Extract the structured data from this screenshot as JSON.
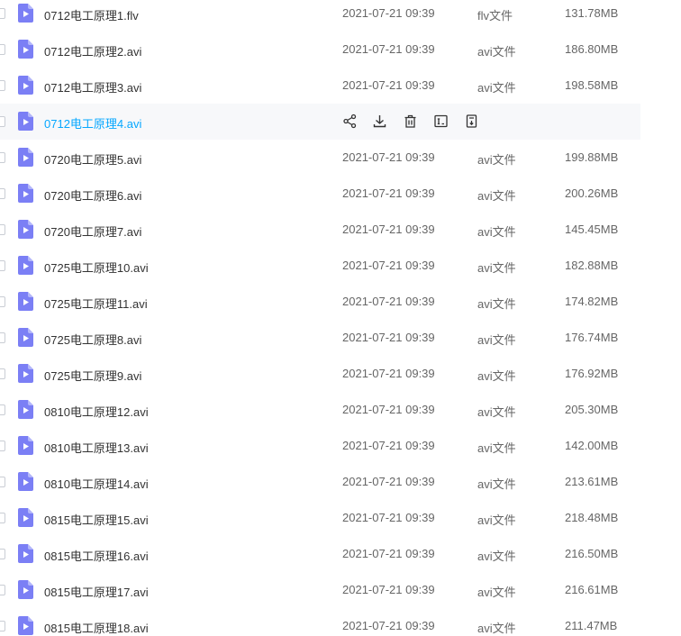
{
  "files": [
    {
      "name": "0712电工原理1.flv",
      "date": "2021-07-21 09:39",
      "type": "flv文件",
      "size": "131.78MB"
    },
    {
      "name": "0712电工原理2.avi",
      "date": "2021-07-21 09:39",
      "type": "avi文件",
      "size": "186.80MB"
    },
    {
      "name": "0712电工原理3.avi",
      "date": "2021-07-21 09:39",
      "type": "avi文件",
      "size": "198.58MB"
    },
    {
      "name": "0712电工原理4.avi",
      "date": "",
      "type": "",
      "size": "",
      "hovered": true
    },
    {
      "name": "0720电工原理5.avi",
      "date": "2021-07-21 09:39",
      "type": "avi文件",
      "size": "199.88MB"
    },
    {
      "name": "0720电工原理6.avi",
      "date": "2021-07-21 09:39",
      "type": "avi文件",
      "size": "200.26MB"
    },
    {
      "name": "0720电工原理7.avi",
      "date": "2021-07-21 09:39",
      "type": "avi文件",
      "size": "145.45MB"
    },
    {
      "name": "0725电工原理10.avi",
      "date": "2021-07-21 09:39",
      "type": "avi文件",
      "size": "182.88MB"
    },
    {
      "name": "0725电工原理11.avi",
      "date": "2021-07-21 09:39",
      "type": "avi文件",
      "size": "174.82MB"
    },
    {
      "name": "0725电工原理8.avi",
      "date": "2021-07-21 09:39",
      "type": "avi文件",
      "size": "176.74MB"
    },
    {
      "name": "0725电工原理9.avi",
      "date": "2021-07-21 09:39",
      "type": "avi文件",
      "size": "176.92MB"
    },
    {
      "name": "0810电工原理12.avi",
      "date": "2021-07-21 09:39",
      "type": "avi文件",
      "size": "205.30MB"
    },
    {
      "name": "0810电工原理13.avi",
      "date": "2021-07-21 09:39",
      "type": "avi文件",
      "size": "142.00MB"
    },
    {
      "name": "0810电工原理14.avi",
      "date": "2021-07-21 09:39",
      "type": "avi文件",
      "size": "213.61MB"
    },
    {
      "name": "0815电工原理15.avi",
      "date": "2021-07-21 09:39",
      "type": "avi文件",
      "size": "218.48MB"
    },
    {
      "name": "0815电工原理16.avi",
      "date": "2021-07-21 09:39",
      "type": "avi文件",
      "size": "216.50MB"
    },
    {
      "name": "0815电工原理17.avi",
      "date": "2021-07-21 09:39",
      "type": "avi文件",
      "size": "216.61MB"
    },
    {
      "name": "0815电工原理18.avi",
      "date": "2021-07-21 09:39",
      "type": "avi文件",
      "size": "211.47MB"
    }
  ],
  "hover_actions": [
    {
      "icon": "share-icon"
    },
    {
      "icon": "download-icon"
    },
    {
      "icon": "delete-icon"
    },
    {
      "icon": "rename-icon"
    },
    {
      "icon": "more-icon"
    }
  ],
  "colors": {
    "accent": "#06a7ff",
    "icon": "#7b7ff5",
    "hover_bg": "#f7f8fa"
  }
}
